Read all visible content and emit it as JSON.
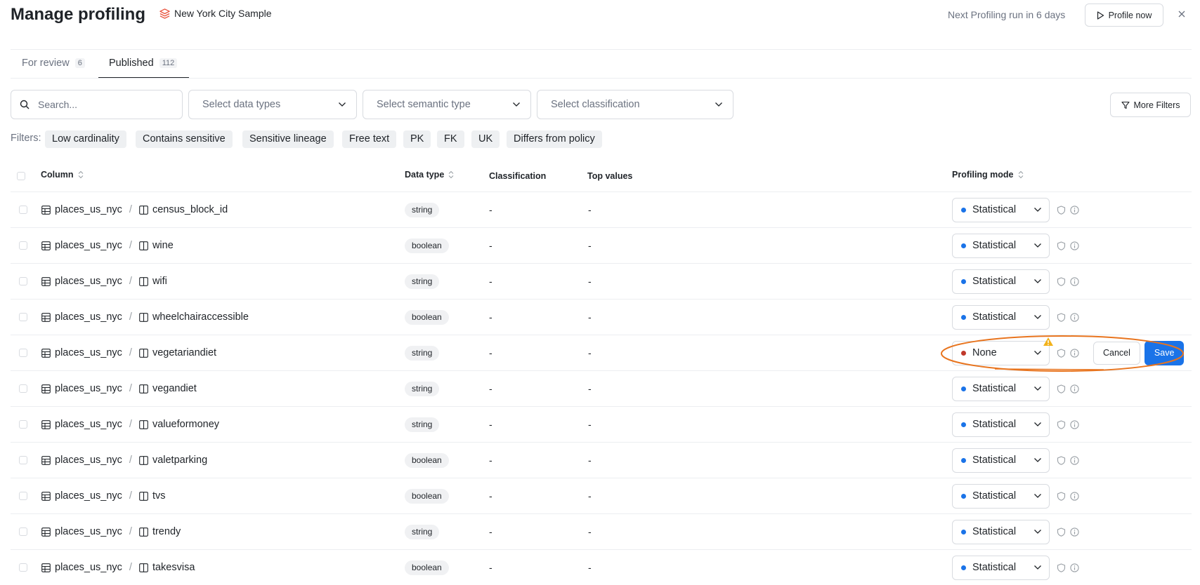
{
  "header": {
    "title": "Manage profiling",
    "dataset": "New York City Sample",
    "next_run": "Next Profiling run in 6 days",
    "profile_now": "Profile now"
  },
  "tabs": [
    {
      "label": "For review",
      "count": "6"
    },
    {
      "label": "Published",
      "count": "112",
      "active": true
    }
  ],
  "search": {
    "placeholder": "Search..."
  },
  "selects": {
    "data_types": "Select data types",
    "semantic_type": "Select semantic type",
    "classification": "Select classification"
  },
  "more_filters": "More Filters",
  "filters": {
    "label": "Filters:",
    "chips": [
      "Low cardinality",
      "Contains sensitive",
      "Sensitive lineage",
      "Free text",
      "PK",
      "FK",
      "UK",
      "Differs from policy"
    ]
  },
  "columns": {
    "column": "Column",
    "data_type": "Data type",
    "classification": "Classification",
    "top_values": "Top values",
    "profiling_mode": "Profiling mode"
  },
  "rows": [
    {
      "table": "places_us_nyc",
      "column": "census_block_id",
      "type": "string",
      "classification": "-",
      "top_values": "-",
      "mode": "Statistical"
    },
    {
      "table": "places_us_nyc",
      "column": "wine",
      "type": "boolean",
      "classification": "-",
      "top_values": "-",
      "mode": "Statistical"
    },
    {
      "table": "places_us_nyc",
      "column": "wifi",
      "type": "string",
      "classification": "-",
      "top_values": "-",
      "mode": "Statistical"
    },
    {
      "table": "places_us_nyc",
      "column": "wheelchairaccessible",
      "type": "boolean",
      "classification": "-",
      "top_values": "-",
      "mode": "Statistical"
    },
    {
      "table": "places_us_nyc",
      "column": "vegetariandiet",
      "type": "string",
      "classification": "-",
      "top_values": "-",
      "mode": "None"
    },
    {
      "table": "places_us_nyc",
      "column": "vegandiet",
      "type": "string",
      "classification": "-",
      "top_values": "-",
      "mode": "Statistical"
    },
    {
      "table": "places_us_nyc",
      "column": "valueformoney",
      "type": "string",
      "classification": "-",
      "top_values": "-",
      "mode": "Statistical"
    },
    {
      "table": "places_us_nyc",
      "column": "valetparking",
      "type": "boolean",
      "classification": "-",
      "top_values": "-",
      "mode": "Statistical"
    },
    {
      "table": "places_us_nyc",
      "column": "tvs",
      "type": "boolean",
      "classification": "-",
      "top_values": "-",
      "mode": "Statistical"
    },
    {
      "table": "places_us_nyc",
      "column": "trendy",
      "type": "string",
      "classification": "-",
      "top_values": "-",
      "mode": "Statistical"
    },
    {
      "table": "places_us_nyc",
      "column": "takesvisa",
      "type": "boolean",
      "classification": "-",
      "top_values": "-",
      "mode": "Statistical"
    }
  ],
  "edit_actions": {
    "cancel": "Cancel",
    "save": "Save"
  },
  "colors": {
    "accent": "#1a73e8",
    "annotation": "#e8741e",
    "warning": "#f2b21b",
    "none_dot": "#c0392b"
  }
}
